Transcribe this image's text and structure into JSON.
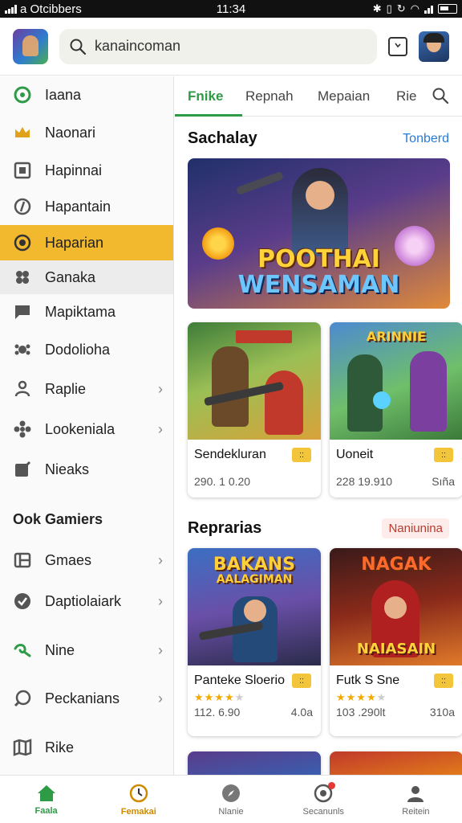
{
  "statusbar": {
    "carrier": "a Otcibbers",
    "time": "11:34"
  },
  "appbar": {
    "search_value": "kanaincoman",
    "icons": [
      "app-logo",
      "search-icon",
      "bookmark-icon",
      "avatar"
    ]
  },
  "sidebar": {
    "items": [
      {
        "label": "Iaana",
        "icon": "circle-ring-icon",
        "color": "#2e9b47",
        "chevron": false
      },
      {
        "label": "Naonari",
        "icon": "crown-icon",
        "color": "#e0a21b",
        "chevron": false
      },
      {
        "label": "Hapinnai",
        "icon": "square-box-icon",
        "color": "#555555",
        "chevron": false
      },
      {
        "label": "Hapantain",
        "icon": "disc-icon",
        "color": "#555555",
        "chevron": false
      },
      {
        "label": "Haparian",
        "icon": "gamepad-circle-icon",
        "color": "#333333",
        "chevron": false,
        "active": true
      },
      {
        "label": "Ganaka",
        "icon": "controller-icon",
        "color": "#555555",
        "chevron": false,
        "hover": true
      },
      {
        "label": "Mapiktama",
        "icon": "chat-icon",
        "color": "#555555",
        "chevron": false
      },
      {
        "label": "Dodolioha",
        "icon": "puzzle-icon",
        "color": "#555555",
        "chevron": false
      },
      {
        "label": "Raplie",
        "icon": "person-icon",
        "color": "#555555",
        "chevron": true
      },
      {
        "label": "Lookeniala",
        "icon": "cog-flower-icon",
        "color": "#555555",
        "chevron": true
      },
      {
        "label": "Nieaks",
        "icon": "edit-box-icon",
        "color": "#555555",
        "chevron": false
      }
    ],
    "section_title": "Ook Gamiers",
    "section_items": [
      {
        "label": "Gmaes",
        "icon": "grid-icon",
        "color": "#555555",
        "chevron": true
      },
      {
        "label": "Daptiolaiark",
        "icon": "check-circle-icon",
        "color": "#555555",
        "chevron": true
      },
      {
        "label": "Nine",
        "icon": "swirl-icon",
        "color": "#2e9b47",
        "chevron": true
      },
      {
        "label": "Peckanians",
        "icon": "search-circle-icon",
        "color": "#555555",
        "chevron": true
      },
      {
        "label": "Rike",
        "icon": "map-icon",
        "color": "#555555",
        "chevron": false
      }
    ]
  },
  "tabs": {
    "items": [
      "Fnike",
      "Repnah",
      "Mepaian",
      "Rie"
    ],
    "active_index": 0
  },
  "featured": {
    "title": "Sachalay",
    "link": "Tonberd",
    "hero_title_line1": "POOTHAI",
    "hero_title_line2": "WENSAMAN"
  },
  "featured_cards": [
    {
      "name": "Sendekluran",
      "meta": "290. 1 0.20",
      "meta2": "",
      "thumb_title": "",
      "badge": "::"
    },
    {
      "name": "Uoneit",
      "meta": "228 19.910",
      "meta2": "Sıña",
      "thumb_title": "ARINNIE",
      "badge": "::"
    }
  ],
  "recent": {
    "title": "Reprarias",
    "pill": "Naniunina"
  },
  "recent_cards": [
    {
      "name": "Pantekе Sloerio",
      "rating": 4,
      "meta": "112. 6.90",
      "meta2": "4.0a",
      "thumb_title_line1": "BAKANS",
      "thumb_title_line2": "AALAGIMAN",
      "badge": "::"
    },
    {
      "name": "Futk S Sne",
      "rating": 4,
      "meta": "103 .290lt",
      "meta2": "310a",
      "thumb_title_line1": "NAGAK",
      "thumb_title_line2": "NAIASAIN",
      "badge": "::"
    }
  ],
  "bottomnav": {
    "items": [
      {
        "label": "Faala",
        "icon": "home-icon",
        "state": "active"
      },
      {
        "label": "Femakai",
        "icon": "clock-icon",
        "state": "orange"
      },
      {
        "label": "Nlanie",
        "icon": "compass-icon",
        "state": "normal"
      },
      {
        "label": "Secanunls",
        "icon": "chat-bubble-icon",
        "state": "normal",
        "notification": true
      },
      {
        "label": "Reitein",
        "icon": "profile-icon",
        "state": "normal"
      }
    ]
  },
  "colors": {
    "accent_green": "#2e9b47",
    "active_yellow": "#f2b82e",
    "link_blue": "#2a7bd4"
  }
}
